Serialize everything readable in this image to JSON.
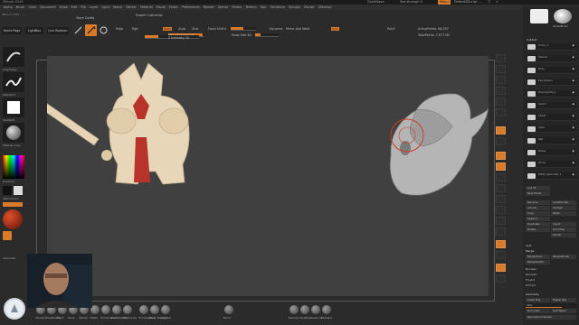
{
  "window": {
    "title": "ZBrush 2019",
    "menu_button": "Menu",
    "quicksave": "QuickSave",
    "see_through": "See-through 0",
    "default_script": "DefaultZScript"
  },
  "menubar": [
    "Alpha",
    "Brush",
    "Color",
    "Document",
    "Draw",
    "Edit",
    "File",
    "Layer",
    "Light",
    "Macro",
    "Marker",
    "Material",
    "Movie",
    "Picker",
    "Preferences",
    "Render",
    "Stencil",
    "Stroke",
    "Texture",
    "Tool",
    "Transform",
    "Zplugin",
    "Zscript",
    "ZStartup"
  ],
  "info_line": "ZBrush 2019 - ... ",
  "shelf": {
    "home_page": "Home Page",
    "lightbox": "LightBox",
    "live_boolean": "Live Boolean",
    "edit": "Edit",
    "draw": "Draw",
    "move": "Move",
    "scale": "Scale",
    "rotate": "Rotate",
    "mrgb": "Mrgb",
    "rgb": "Rgb",
    "m": "M",
    "zadd": "Zadd",
    "zsub": "Zsub",
    "zcut": "Zcut",
    "focal_shift": "Focal Shift 0",
    "z_intensity": "Z Intensity 25",
    "draw_size": "Draw Size 64",
    "rgb_intensity": "Rgb Intensity 100",
    "dynamic": "Dynamic",
    "mirror_weld": "Mirror And Weld",
    "sym": "Sym",
    "active_points": "ActivePoints: 66,397",
    "total_points": "TotalPoints: 7.877 Mil",
    "poly_f": "PolyF",
    "enable_customize": "Enable Customize",
    "store_config": "Store Config"
  },
  "left_shelf": [
    {
      "label": "ClayTubes"
    },
    {
      "label": "Standard"
    },
    {
      "label": "AlphaOff"
    },
    {
      "label": "MatCap Gray"
    },
    {
      "label": "Gradient"
    },
    {
      "label": "SwitchColor"
    },
    {
      "label": "Alternate"
    }
  ],
  "right_tray": {
    "ghost_label": "SimpleBrush",
    "subtool_title": "Subtool",
    "subtools": [
      {
        "name": "Armor_1"
      },
      {
        "name": "Helmet"
      },
      {
        "name": "Body"
      },
      {
        "name": "Eye_Sphere"
      },
      {
        "name": "Polymesh3D_1"
      },
      {
        "name": "Sword"
      },
      {
        "name": "Shield"
      },
      {
        "name": "Cape"
      },
      {
        "name": "Belt"
      },
      {
        "name": "Plates"
      },
      {
        "name": "Horns"
      },
      {
        "name": "PM3D_Sphere3D_1"
      }
    ],
    "list_all": "List All",
    "new_folder": "New Folder",
    "buttons": [
      {
        "a": "Rename",
        "b": "AutoReorder"
      },
      {
        "a": "All Low",
        "b": "All High"
      },
      {
        "a": "Copy",
        "b": "Paste"
      },
      {
        "a": "Append",
        "b": ""
      },
      {
        "a": "Duplicate",
        "b": "Insert"
      },
      {
        "a": "Delete",
        "b": "Del Other"
      },
      {
        "a": "",
        "b": "Del All"
      }
    ],
    "split": "Split",
    "merge": "Merge",
    "merge_down": "MergeDown",
    "merge_similar": "MergeSimilar",
    "merge_visible": "MergeVisible",
    "boolean": "Boolean",
    "remesh": "Remesh",
    "project": "Project",
    "extract": "Extract",
    "geometry": "Geometry",
    "lower_res": "Lower Res",
    "higher_res": "Higher Res",
    "sdiv": "SDiv",
    "del_lower": "Del Lower",
    "del_higher": "Del Higher",
    "reconstruct": "Reconstruct Subdiv"
  },
  "bottom_bar": [
    "Standard",
    "ClayBuildup",
    "Pinch",
    "Move",
    "hPolish",
    "Inflate",
    "TrimDynamic",
    "DamStandard",
    "Orb_Cracks",
    "TrimAdaptive",
    "Move Topological",
    "Alpha",
    "Mirror",
    "Remesh",
    "TopoRep",
    "Resize All",
    "Reshape"
  ],
  "colors": {
    "accent": "#d97a2a",
    "background": "#2b2b2b",
    "viewport": "#404040",
    "warrior_body": "#e8d6b8",
    "warrior_red": "#b8342a"
  }
}
